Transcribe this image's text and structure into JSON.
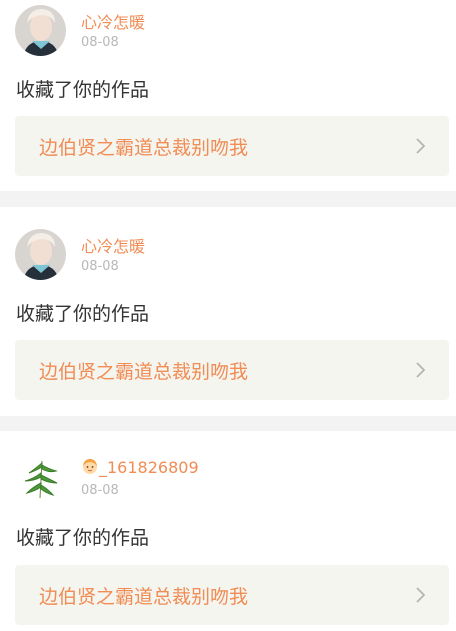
{
  "colors": {
    "accent": "#f08c54",
    "text_primary": "#333333",
    "text_muted": "#b8b8b8",
    "link_bg": "#f5f5f0",
    "separator": "#f3f3f3"
  },
  "notifications": [
    {
      "username": "心冷怎暖",
      "date": "08-08",
      "action": "收藏了你的作品",
      "work_title": "边伯贤之霸道总裁别吻我",
      "avatar_icon": "avatar-person-icon",
      "link_icon": "chevron-right-icon"
    },
    {
      "username": "心冷怎暖",
      "date": "08-08",
      "action": "收藏了你的作品",
      "work_title": "边伯贤之霸道总裁别吻我",
      "avatar_icon": "avatar-person-icon",
      "link_icon": "chevron-right-icon"
    },
    {
      "username": "_161826809",
      "username_prefix_icon": "child-emoji-icon",
      "date": "08-08",
      "action": "收藏了你的作品",
      "work_title": "边伯贤之霸道总裁别吻我",
      "avatar_icon": "avatar-leaf-icon",
      "link_icon": "chevron-right-icon"
    }
  ]
}
